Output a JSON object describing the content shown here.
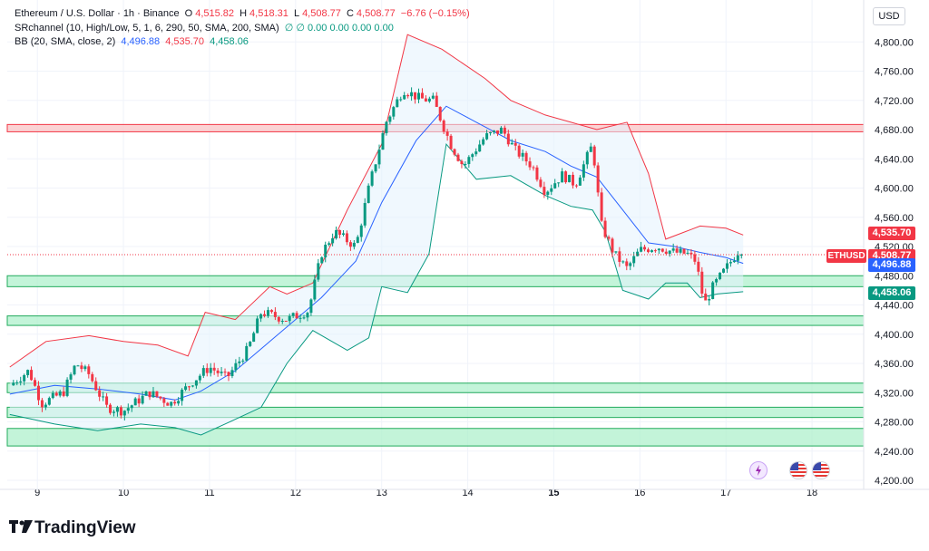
{
  "header": {
    "symbol": "Ethereum / U.S. Dollar · 1h · Binance",
    "open_label": "O",
    "open": "4,515.82",
    "high_label": "H",
    "high": "4,518.31",
    "low_label": "L",
    "low": "4,508.77",
    "close_label": "C",
    "close": "4,508.77",
    "change": "−6.76 (−0.15%)",
    "indicator1_name": "SRchannel (10, High/Low, 5, 1, 6, 290, 50, SMA, 200, SMA)",
    "indicator1_values": "∅  ∅  0.00  0.00  0.00  0.00",
    "indicator2_name": "BB (20, SMA, close, 2)",
    "bb_basis": "4,496.88",
    "bb_upper": "4,535.70",
    "bb_lower": "4,458.06"
  },
  "currency_button": "USD",
  "symbol_tag": "ETHUSD",
  "price_tags": {
    "upper": "4,535.70",
    "last": "4,508.77",
    "basis": "4,496.88",
    "lower": "4,458.06"
  },
  "brand": "TradingView",
  "colors": {
    "up": "#089981",
    "down": "#F23645",
    "basis": "#2962FF",
    "upper_band": "#F23645",
    "lower_band": "#089981",
    "band_fill": "#E3F2FD",
    "support_zone": "#A9F0C9",
    "resistance_zone": "#F9C4C6"
  },
  "icons": [
    "lightning-icon",
    "us-flag-icon",
    "us-flag-icon"
  ],
  "chart_data": {
    "type": "candlestick",
    "title": "Ethereum / U.S. Dollar · 1h · Binance",
    "ylim": [
      4200,
      4840
    ],
    "y_ticks": [
      4200,
      4240,
      4280,
      4320,
      4360,
      4400,
      4440,
      4480,
      4520,
      4560,
      4600,
      4640,
      4680,
      4720,
      4760,
      4800
    ],
    "y_tick_labels": [
      "4,200.00",
      "4,240.00",
      "4,280.00",
      "4,320.00",
      "4,360.00",
      "4,400.00",
      "4,440.00",
      "4,480.00",
      "4,520.00",
      "4,560.00",
      "4,600.00",
      "4,640.00",
      "4,680.00",
      "4,720.00",
      "4,760.00",
      "4,800.00"
    ],
    "x_ticks": [
      9,
      10,
      11,
      12,
      13,
      14,
      15,
      16,
      17,
      18
    ],
    "x_tick_labels": [
      "9",
      "10",
      "11",
      "12",
      "13",
      "14",
      "15",
      "16",
      "17",
      "18"
    ],
    "xlim": [
      8.65,
      18.6
    ],
    "grid": true,
    "zones": [
      {
        "kind": "resistance",
        "from": 4677,
        "to": 4687
      },
      {
        "kind": "support",
        "from": 4465,
        "to": 4480
      },
      {
        "kind": "support",
        "from": 4412,
        "to": 4425
      },
      {
        "kind": "support",
        "from": 4320,
        "to": 4333
      },
      {
        "kind": "support",
        "from": 4286,
        "to": 4300
      },
      {
        "kind": "support",
        "from": 4247,
        "to": 4271
      }
    ],
    "price_anchors": [
      [
        8.68,
        4330
      ],
      [
        8.9,
        4350
      ],
      [
        9.05,
        4305
      ],
      [
        9.3,
        4320
      ],
      [
        9.45,
        4360
      ],
      [
        9.6,
        4345
      ],
      [
        9.8,
        4300
      ],
      [
        10.0,
        4295
      ],
      [
        10.3,
        4320
      ],
      [
        10.55,
        4305
      ],
      [
        10.8,
        4335
      ],
      [
        11.0,
        4355
      ],
      [
        11.2,
        4340
      ],
      [
        11.45,
        4380
      ],
      [
        11.6,
        4430
      ],
      [
        11.9,
        4420
      ],
      [
        12.15,
        4432
      ],
      [
        12.3,
        4510
      ],
      [
        12.45,
        4540
      ],
      [
        12.7,
        4520
      ],
      [
        12.85,
        4600
      ],
      [
        13.05,
        4690
      ],
      [
        13.25,
        4735
      ],
      [
        13.45,
        4722
      ],
      [
        13.6,
        4720
      ],
      [
        13.8,
        4660
      ],
      [
        13.95,
        4630
      ],
      [
        14.2,
        4670
      ],
      [
        14.4,
        4680
      ],
      [
        14.55,
        4652
      ],
      [
        14.75,
        4630
      ],
      [
        14.9,
        4595
      ],
      [
        15.1,
        4618
      ],
      [
        15.25,
        4605
      ],
      [
        15.45,
        4660
      ],
      [
        15.55,
        4550
      ],
      [
        15.7,
        4510
      ],
      [
        15.85,
        4490
      ],
      [
        16.0,
        4515
      ],
      [
        16.2,
        4520
      ],
      [
        16.4,
        4512
      ],
      [
        16.55,
        4510
      ],
      [
        16.65,
        4500
      ],
      [
        16.75,
        4440
      ],
      [
        16.85,
        4465
      ],
      [
        17.0,
        4490
      ],
      [
        17.15,
        4515
      ],
      [
        17.2,
        4508.77
      ]
    ],
    "bollinger": {
      "basis": [
        [
          8.68,
          4318
        ],
        [
          9.2,
          4330
        ],
        [
          9.7,
          4325
        ],
        [
          10.2,
          4318
        ],
        [
          10.6,
          4310
        ],
        [
          10.9,
          4322
        ],
        [
          11.3,
          4350
        ],
        [
          11.7,
          4390
        ],
        [
          12.0,
          4420
        ],
        [
          12.3,
          4450
        ],
        [
          12.7,
          4500
        ],
        [
          13.0,
          4580
        ],
        [
          13.4,
          4665
        ],
        [
          13.75,
          4712
        ],
        [
          14.1,
          4690
        ],
        [
          14.5,
          4665
        ],
        [
          14.9,
          4650
        ],
        [
          15.2,
          4630
        ],
        [
          15.5,
          4615
        ],
        [
          15.8,
          4570
        ],
        [
          16.1,
          4525
        ],
        [
          16.4,
          4520
        ],
        [
          16.7,
          4512
        ],
        [
          17.0,
          4505
        ],
        [
          17.2,
          4496.88
        ]
      ],
      "upper": [
        [
          8.68,
          4355
        ],
        [
          9.1,
          4390
        ],
        [
          9.6,
          4398
        ],
        [
          10.0,
          4390
        ],
        [
          10.4,
          4385
        ],
        [
          10.75,
          4370
        ],
        [
          10.95,
          4430
        ],
        [
          11.3,
          4420
        ],
        [
          11.7,
          4465
        ],
        [
          11.9,
          4455
        ],
        [
          12.2,
          4470
        ],
        [
          12.6,
          4570
        ],
        [
          13.0,
          4660
        ],
        [
          13.3,
          4810
        ],
        [
          13.7,
          4790
        ],
        [
          14.2,
          4750
        ],
        [
          14.5,
          4720
        ],
        [
          14.9,
          4700
        ],
        [
          15.2,
          4690
        ],
        [
          15.5,
          4680
        ],
        [
          15.85,
          4690
        ],
        [
          16.1,
          4620
        ],
        [
          16.3,
          4530
        ],
        [
          16.7,
          4548
        ],
        [
          17.0,
          4545
        ],
        [
          17.2,
          4535.7
        ]
      ],
      "lower": [
        [
          8.68,
          4290
        ],
        [
          9.2,
          4277
        ],
        [
          9.7,
          4268
        ],
        [
          10.2,
          4277
        ],
        [
          10.6,
          4272
        ],
        [
          10.9,
          4262
        ],
        [
          11.2,
          4278
        ],
        [
          11.6,
          4300
        ],
        [
          11.9,
          4360
        ],
        [
          12.2,
          4405
        ],
        [
          12.6,
          4378
        ],
        [
          12.85,
          4395
        ],
        [
          13.0,
          4465
        ],
        [
          13.3,
          4457
        ],
        [
          13.55,
          4510
        ],
        [
          13.75,
          4660
        ],
        [
          14.1,
          4612
        ],
        [
          14.5,
          4617
        ],
        [
          14.9,
          4590
        ],
        [
          15.2,
          4575
        ],
        [
          15.45,
          4570
        ],
        [
          15.6,
          4540
        ],
        [
          15.8,
          4460
        ],
        [
          16.1,
          4448
        ],
        [
          16.3,
          4470
        ],
        [
          16.55,
          4470
        ],
        [
          16.7,
          4450
        ],
        [
          16.9,
          4455
        ],
        [
          17.2,
          4458.06
        ]
      ]
    },
    "last_close": 4508.77,
    "bb_upper": 4535.7,
    "bb_basis": 4496.88,
    "bb_lower": 4458.06
  }
}
